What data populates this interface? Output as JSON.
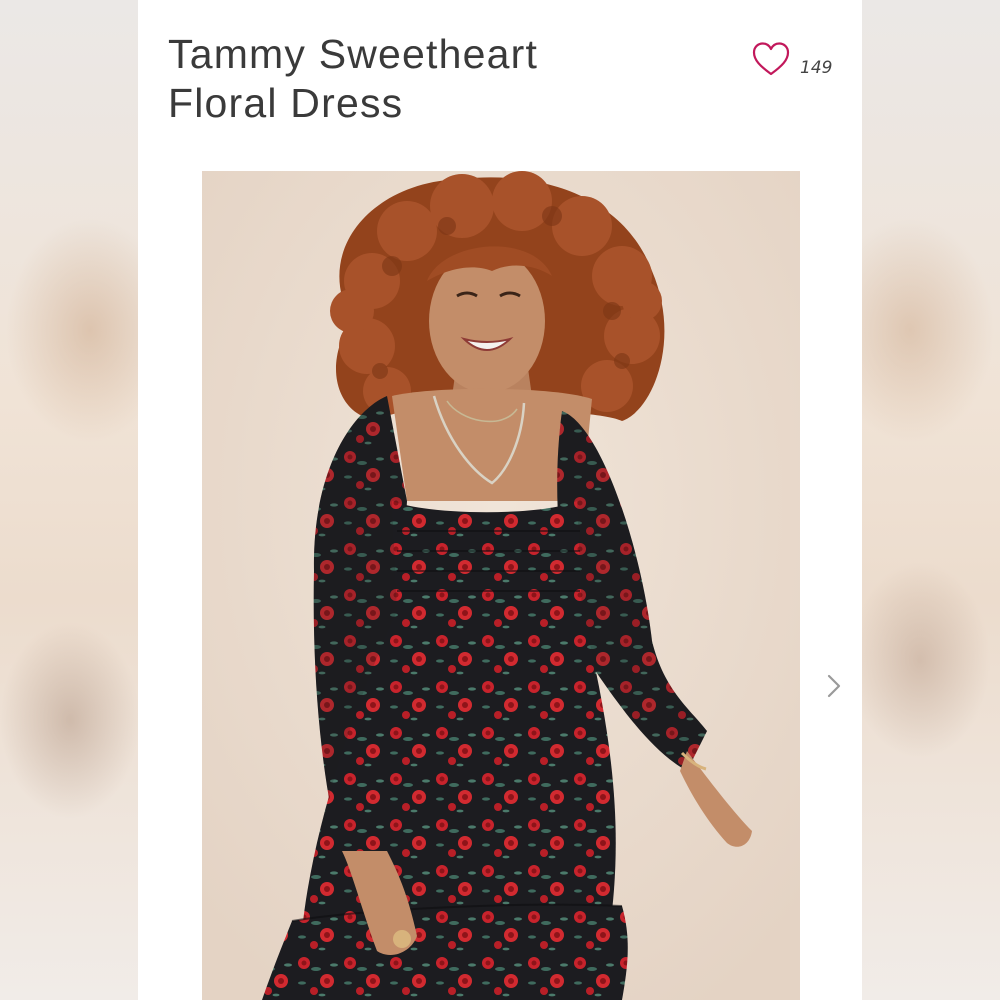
{
  "product": {
    "title": "Tammy Sweetheart Floral Dress",
    "like_count": "149",
    "image_alt": "Model wearing a black floral long-sleeve dress with red roses"
  },
  "icons": {
    "like": "heart-outline-icon",
    "next": "chevron-right-icon"
  },
  "colors": {
    "accent": "#c2185b",
    "title_text": "#3a3a3a",
    "photo_background": "#ecdfd2",
    "dress": "#1c1c20",
    "rose": "#c8232c",
    "hair": "#9a4a22"
  }
}
